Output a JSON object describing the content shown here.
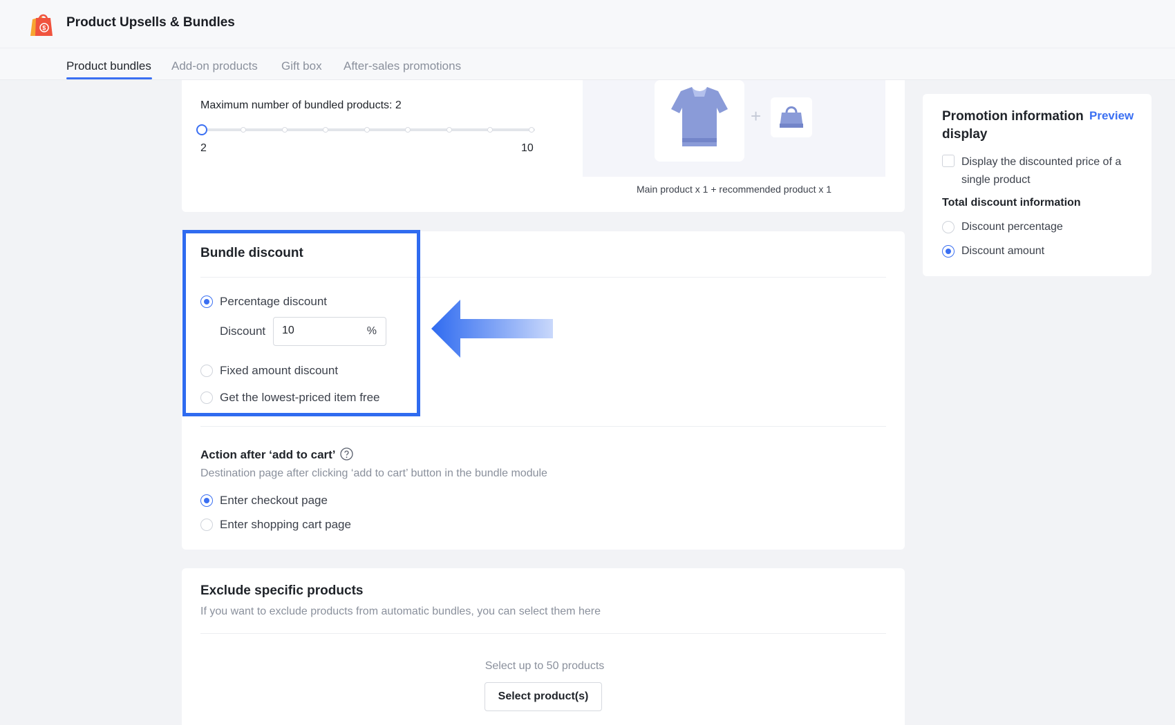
{
  "header": {
    "title": "Product Upsells & Bundles",
    "logo_icon": "shopping-bag-icon"
  },
  "tabs": [
    {
      "label": "Product bundles",
      "active": true
    },
    {
      "label": "Add-on products",
      "active": false
    },
    {
      "label": "Gift box",
      "active": false
    },
    {
      "label": "After-sales promotions",
      "active": false
    }
  ],
  "bundle_settings": {
    "max_label": "Maximum number of bundled products: 2",
    "slider": {
      "min": "2",
      "max": "10",
      "value": 2
    },
    "preview_caption": "Main product x 1 + recommended product x 1",
    "plus": "+"
  },
  "bundle_discount": {
    "title": "Bundle discount",
    "options": [
      {
        "label": "Percentage discount",
        "checked": true
      },
      {
        "label": "Fixed amount discount",
        "checked": false
      },
      {
        "label": "Get the lowest-priced item free",
        "checked": false
      }
    ],
    "discount_label": "Discount",
    "discount_value": "10",
    "discount_suffix": "%"
  },
  "cart_action": {
    "title": "Action after ‘add to cart’",
    "description": "Destination page after clicking ‘add to cart’ button in the bundle module",
    "options": [
      {
        "label": "Enter checkout page",
        "checked": true
      },
      {
        "label": "Enter shopping cart page",
        "checked": false
      }
    ]
  },
  "exclude": {
    "title": "Exclude specific products",
    "description": "If you want to exclude products from automatic bundles, you can select them here",
    "hint": "Select up to 50 products",
    "button_label": "Select product(s)"
  },
  "sidebar": {
    "title": "Promotion information display",
    "preview_label": "Preview",
    "checkbox_label": "Display the discounted price of a single product",
    "total_title": "Total discount information",
    "options": [
      {
        "label": "Discount percentage",
        "checked": false
      },
      {
        "label": "Discount amount",
        "checked": true
      }
    ]
  },
  "colors": {
    "accent": "#3a6ff2",
    "highlight": "#2f6bf0"
  }
}
